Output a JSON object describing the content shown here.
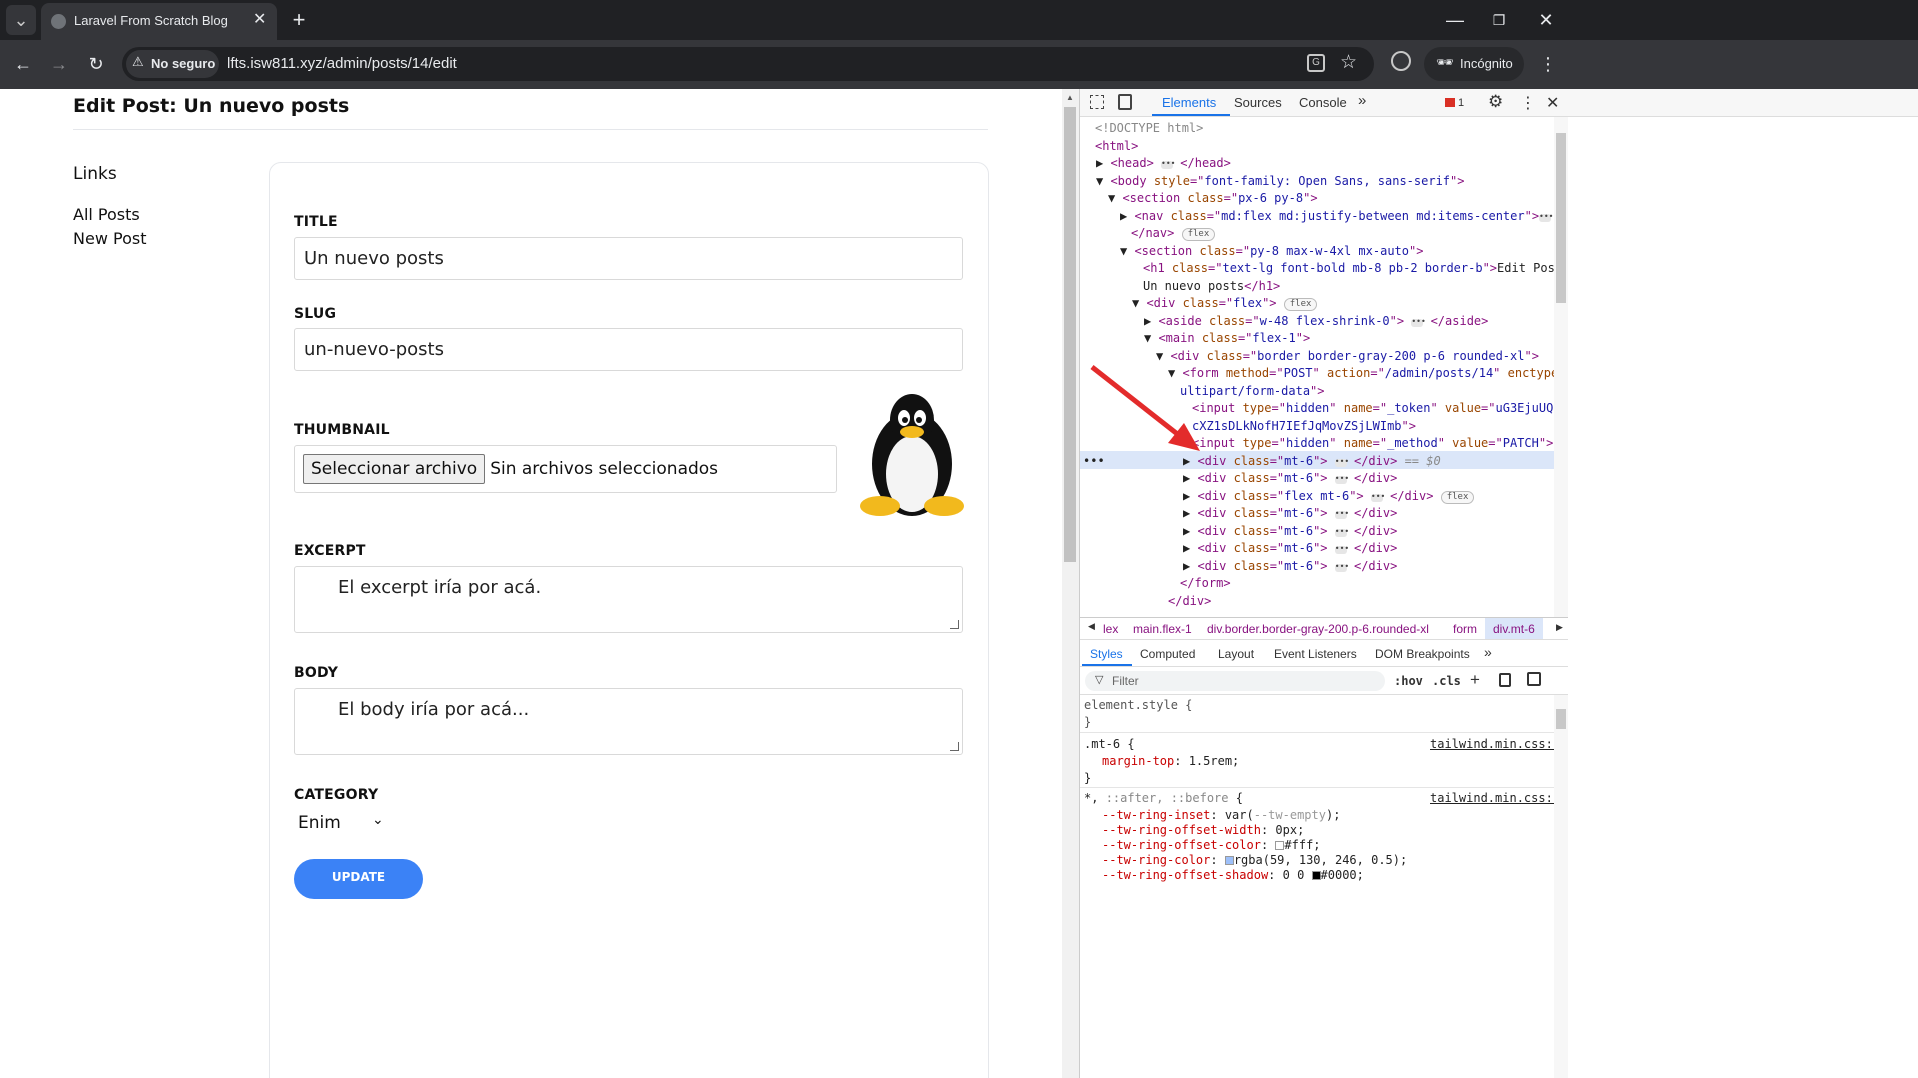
{
  "browser": {
    "tab_title": "Laravel From Scratch Blog",
    "not_secure_label": "No seguro",
    "url": "lfts.isw811.xyz/admin/posts/14/edit",
    "incognito_label": "Incógnito"
  },
  "page": {
    "heading": "Edit Post: Un nuevo posts",
    "sidebar": {
      "title": "Links",
      "links": [
        "All Posts",
        "New Post"
      ]
    },
    "form": {
      "title_label": "TITLE",
      "title_value": "Un nuevo posts",
      "slug_label": "SLUG",
      "slug_value": "un-nuevo-posts",
      "thumbnail_label": "THUMBNAIL",
      "file_button": "Seleccionar archivo",
      "file_status": "Sin archivos seleccionados",
      "excerpt_label": "EXCERPT",
      "excerpt_value": "El excerpt iría por acá.",
      "body_label": "BODY",
      "body_value": "El body iría por acá...",
      "category_label": "CATEGORY",
      "category_value": "Enim",
      "submit_label": "UPDATE"
    }
  },
  "devtools": {
    "tabs": [
      "Elements",
      "Sources",
      "Console"
    ],
    "error_count": "1",
    "breadcrumb": [
      "lex",
      "main.flex-1",
      "div.border.border-gray-200.p-6.rounded-xl",
      "form",
      "div.mt-6"
    ],
    "style_tabs": [
      "Styles",
      "Computed",
      "Layout",
      "Event Listeners",
      "DOM Breakpoints"
    ],
    "filter_placeholder": "Filter",
    "hov_label": ":hov",
    "cls_label": ".cls"
  },
  "colors": {
    "accent_blue": "#1f6fde",
    "update_button": "#3b82f6"
  }
}
